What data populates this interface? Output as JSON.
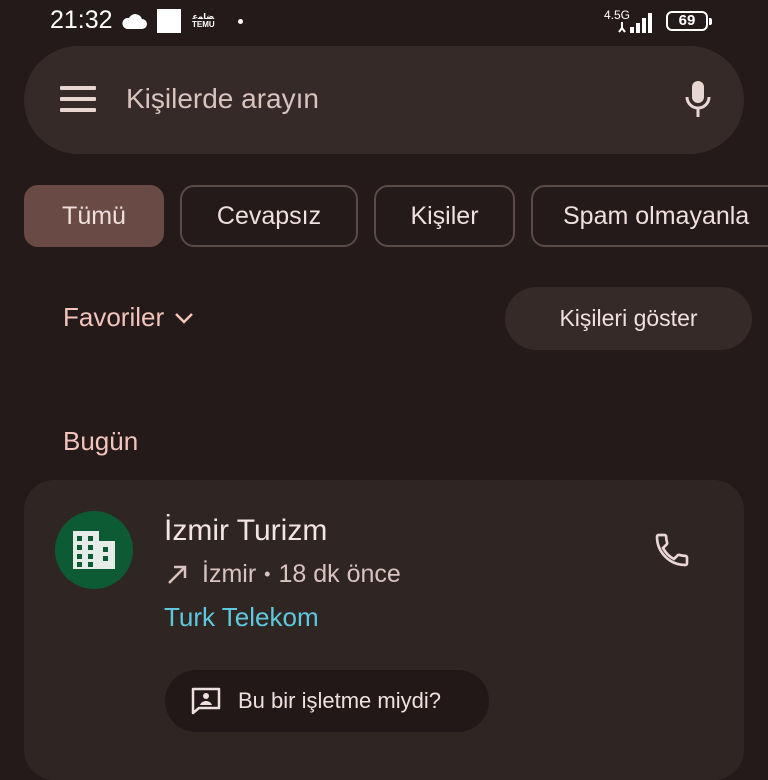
{
  "status_bar": {
    "time": "21:32",
    "temu_top": "ﻀﺎﻤﻋ",
    "temu_label": "TEMU",
    "network": "4.5G",
    "battery": "69"
  },
  "search": {
    "placeholder": "Kişilerde arayın"
  },
  "chips": [
    {
      "label": "Tümü",
      "active": true
    },
    {
      "label": "Cevapsız"
    },
    {
      "label": "Kişiler"
    },
    {
      "label": "Spam olmayanla"
    }
  ],
  "favorites": {
    "label": "Favoriler",
    "show_contacts": "Kişileri göster"
  },
  "section": {
    "title": "Bugün"
  },
  "call": {
    "name": "İzmir Turizm",
    "location": "İzmir",
    "separator": "•",
    "time_ago": "18 dk önce",
    "carrier": "Turk Telekom",
    "business_prompt": "Bu bir işletme miydi?"
  },
  "colors": {
    "background": "#241a19",
    "chip_active": "#6a4a45",
    "accent_text": "#f3c4bb",
    "carrier_text": "#5ec8dd",
    "avatar": "#0d5b35"
  }
}
